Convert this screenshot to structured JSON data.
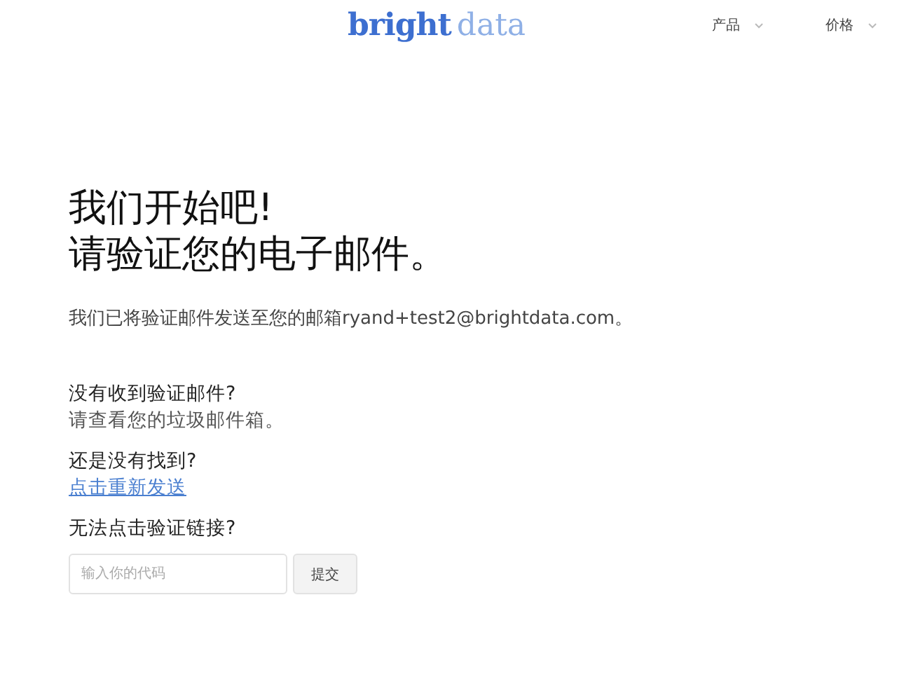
{
  "header": {
    "logo": {
      "part_1": "bright",
      "part_2": "data"
    },
    "nav": [
      {
        "label": "产品"
      },
      {
        "label": "价格"
      }
    ]
  },
  "heading": [
    "我们开始吧!",
    "请验证您的电子邮件。"
  ],
  "message": "我们已将验证邮件发送至您的邮箱ryand+test2@brightdata.com。",
  "sections": [
    {
      "kind": "text",
      "title": "没有收到验证邮件?",
      "body": "请查看您的垃圾邮件箱。"
    },
    {
      "kind": "link",
      "title": "还是没有找到?",
      "body": "点击重新发送"
    },
    {
      "kind": "form",
      "title": "无法点击验证链接?",
      "placeholder": "输入你的代码",
      "button": "提交"
    }
  ]
}
